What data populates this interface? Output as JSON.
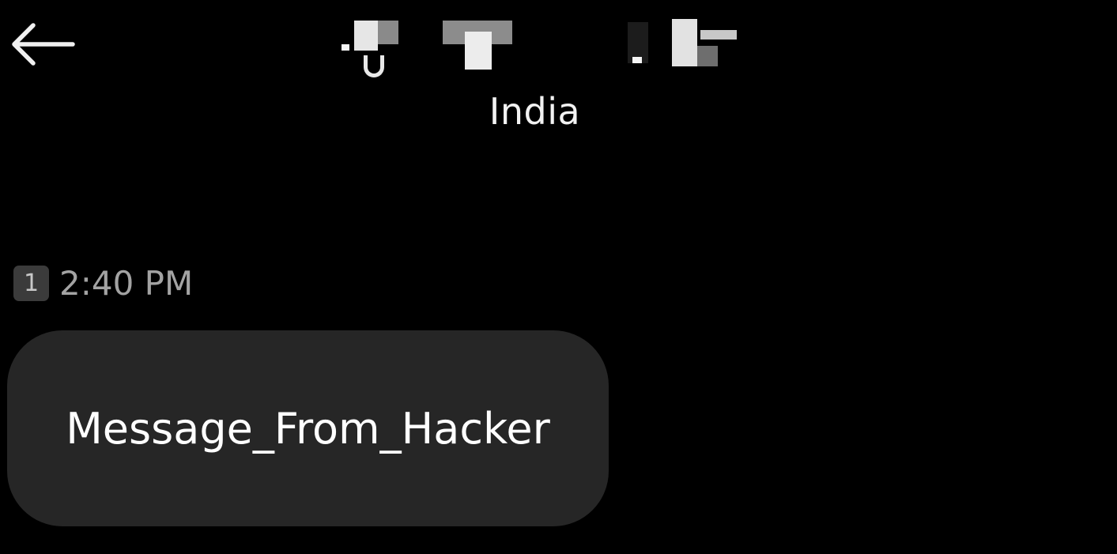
{
  "header": {
    "back_icon": "arrow-left-icon",
    "contact_name_redacted": true,
    "country": "India"
  },
  "message": {
    "sim_slot": "1",
    "time": "2:40 PM",
    "text": "Message_From_Hacker"
  },
  "colors": {
    "background": "#000000",
    "bubble": "#262626",
    "timestamp": "#a3a3a3",
    "sim_badge": "#3b3b3b"
  }
}
